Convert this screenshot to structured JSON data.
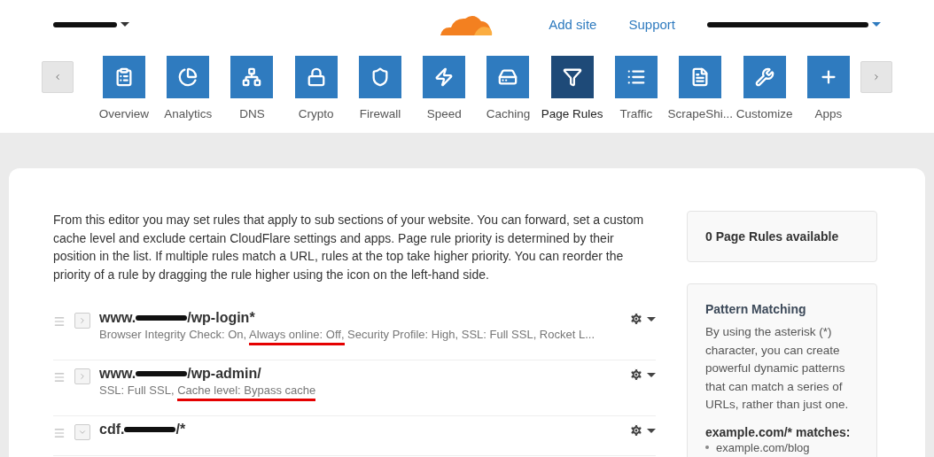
{
  "header": {
    "links": [
      "Add site",
      "Support"
    ]
  },
  "nav": [
    {
      "label": "Overview",
      "selected": false
    },
    {
      "label": "Analytics",
      "selected": false
    },
    {
      "label": "DNS",
      "selected": false
    },
    {
      "label": "Crypto",
      "selected": false
    },
    {
      "label": "Firewall",
      "selected": false
    },
    {
      "label": "Speed",
      "selected": false
    },
    {
      "label": "Caching",
      "selected": false
    },
    {
      "label": "Page Rules",
      "selected": true
    },
    {
      "label": "Traffic",
      "selected": false
    },
    {
      "label": "ScrapeShi...",
      "selected": false
    },
    {
      "label": "Customize",
      "selected": false
    },
    {
      "label": "Apps",
      "selected": false
    }
  ],
  "intro": "From this editor you may set rules that apply to sub sections of your website. You can forward, set a custom cache level and exclude certain CloudFlare settings and apps. Page rule priority is determined by their position in the list. If multiple rules match a URL, rules at the top take higher priority. You can reorder the priority of a rule by dragging the rule higher using the icon on the left-hand side.",
  "rules": [
    {
      "prefix": "www.",
      "suffix": "/wp-login*",
      "expanded": false,
      "details": [
        {
          "text": "Browser Integrity Check: On, ",
          "underlined": false
        },
        {
          "text": "Always online: Off,",
          "underlined": true
        },
        {
          "text": " Security Profile: High, SSL: Full SSL, Rocket L...",
          "underlined": false
        }
      ]
    },
    {
      "prefix": "www.",
      "suffix": "/wp-admin/",
      "expanded": false,
      "details": [
        {
          "text": "SSL: Full SSL, ",
          "underlined": false
        },
        {
          "text": "Cache level: Bypass cache",
          "underlined": true
        }
      ]
    },
    {
      "prefix": "cdf.",
      "suffix": "/*",
      "expanded": true
    }
  ],
  "sidebar": {
    "available": "0 Page Rules available",
    "pattern_title": "Pattern Matching",
    "pattern_text": "By using the asterisk (*) character, you can create powerful dynamic patterns that can match a series of URLs, rather than just one.",
    "matches_title": "example.com/* matches:",
    "matches": [
      "example.com/blog"
    ]
  }
}
